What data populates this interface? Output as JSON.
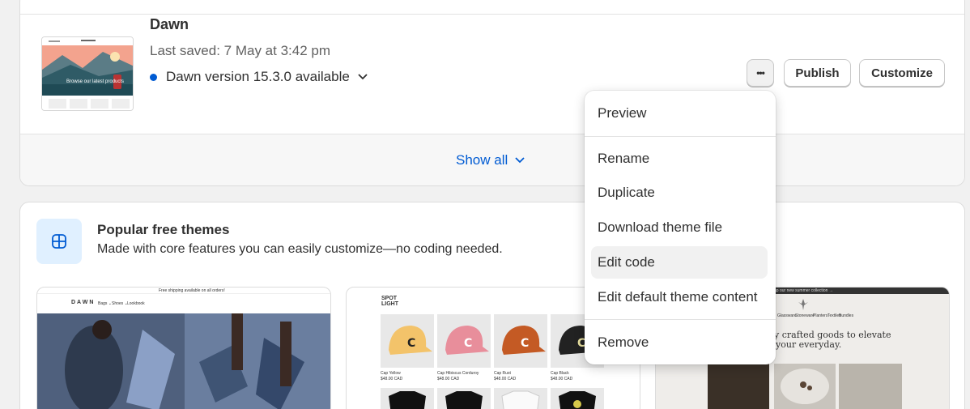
{
  "current_theme": {
    "name": "Dawn",
    "last_saved": "Last saved: 7 May at 3:42 pm",
    "version_notice": "Dawn version 15.3.0 available",
    "thumbnail_text": "Browse our latest products",
    "actions": {
      "more_label": "•••",
      "publish": "Publish",
      "customize": "Customize"
    },
    "show_all": "Show all"
  },
  "menu": {
    "items": [
      "Preview",
      "Rename",
      "Duplicate",
      "Download theme file",
      "Edit code",
      "Edit default theme content",
      "Remove"
    ],
    "active": "Edit code"
  },
  "popular": {
    "title": "Popular free themes",
    "subtitle": "Made with core features you can easily customize—no coding needed.",
    "dawn_preview": {
      "banner": "Free shipping available on all orders!",
      "logo": "DAWN",
      "nav": [
        "Bags ⌄",
        "Shoes ⌄",
        "Lookbook"
      ]
    },
    "spotlight_preview": {
      "logo_line1": "SPOT",
      "logo_line2": "LIGHT",
      "products": [
        {
          "name": "Cap Yellow",
          "price": "$48.00 CAD"
        },
        {
          "name": "Cap Hibiscus Corduroy",
          "price": "$48.00 CAD"
        },
        {
          "name": "Cap Rust",
          "price": "$48.00 CAD"
        },
        {
          "name": "Cap Black",
          "price": "$48.00 CAD"
        }
      ]
    },
    "third_preview": {
      "banner": "ap our new summer collection →",
      "nav": [
        "Glassware",
        "Stoneware",
        "Planters",
        "Textiles",
        "Bundles"
      ],
      "headline_1": "y crafted goods to elevate",
      "headline_2": "your everyday."
    }
  },
  "colors": {
    "accent": "#005bd3",
    "menu_active_bg": "#f1f1f1",
    "icon_bg": "#e0f0ff"
  }
}
